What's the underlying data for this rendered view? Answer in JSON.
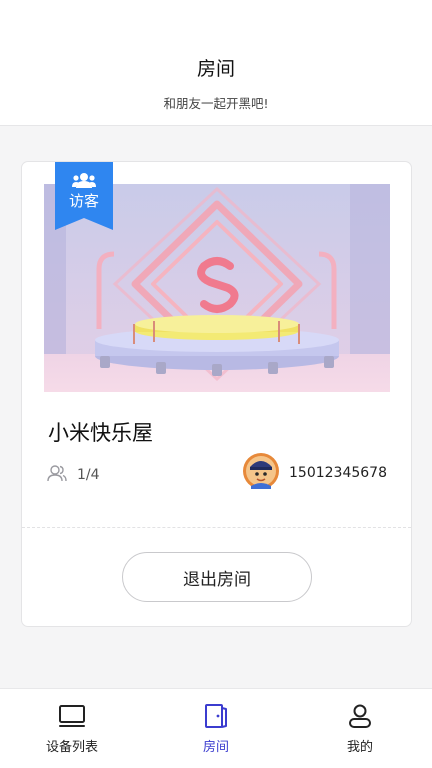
{
  "header": {
    "title": "房间",
    "subtitle": "和朋友一起开黑吧!"
  },
  "room_card": {
    "guest_badge": "访客",
    "room_name": "小米快乐屋",
    "member_count": "1/4",
    "owner_phone": "15012345678",
    "exit_button": "退出房间"
  },
  "tabbar": {
    "tabs": [
      {
        "label": "设备列表",
        "icon": "monitor-icon",
        "active": false
      },
      {
        "label": "房间",
        "icon": "door-icon",
        "active": true
      },
      {
        "label": "我的",
        "icon": "user-icon",
        "active": false
      }
    ]
  },
  "colors": {
    "accent": "#3b3ccf",
    "badge_blue": "#2f86f0",
    "page_bg": "#f5f5f6"
  }
}
